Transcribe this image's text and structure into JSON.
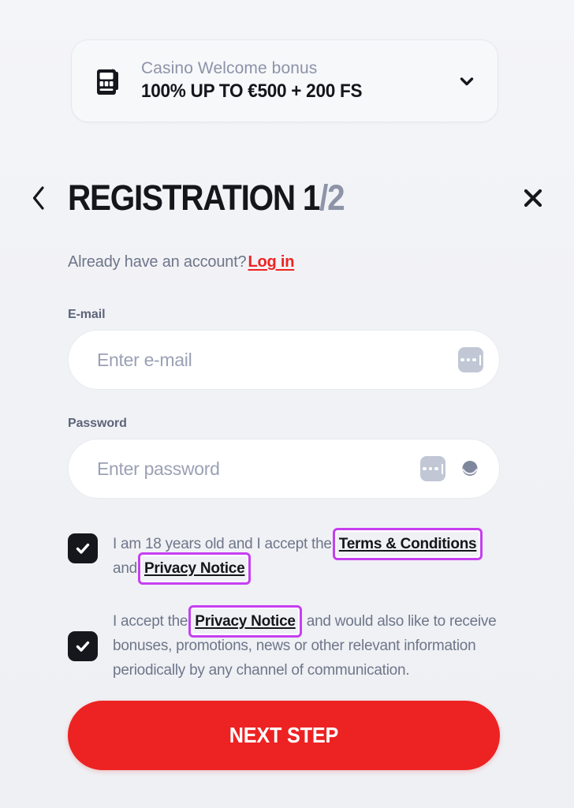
{
  "bonus": {
    "icon": "slot-machine-icon",
    "title": "Casino Welcome bonus",
    "amount": "100% UP TO €500 + 200 FS",
    "expand_icon": "chevron-down-icon"
  },
  "header": {
    "back_icon": "chevron-left-icon",
    "title_main": "REGISTRATION 1",
    "title_step_total": "/2",
    "close_icon": "close-icon"
  },
  "account": {
    "prompt": "Already have an account?",
    "login_label": "Log in"
  },
  "fields": {
    "email": {
      "label": "E-mail",
      "placeholder": "Enter e-mail",
      "value": "",
      "autofill_icon": "autofill-dots-icon"
    },
    "password": {
      "label": "Password",
      "placeholder": "Enter password",
      "value": "",
      "autofill_icon": "autofill-dots-icon",
      "visibility_icon": "eye-icon"
    }
  },
  "consents": [
    {
      "checked": true,
      "text_before": "I am 18 years old and I accept the",
      "link1": "Terms & Conditions",
      "text_middle": "and",
      "link2": "Privacy Notice",
      "text_after": ""
    },
    {
      "checked": true,
      "text_before": "I accept the",
      "link1": "Privacy Notice",
      "text_after": ", and would also like to receive bonuses, promotions, news or other relevant information periodically by any channel of communication."
    }
  ],
  "submit": {
    "label": "NEXT STEP"
  },
  "colors": {
    "accent_red": "#ed2222",
    "highlight_purple": "#c63ff0",
    "text_dark": "#15161c",
    "text_muted": "#6e7689",
    "background": "#f1f2f6"
  }
}
